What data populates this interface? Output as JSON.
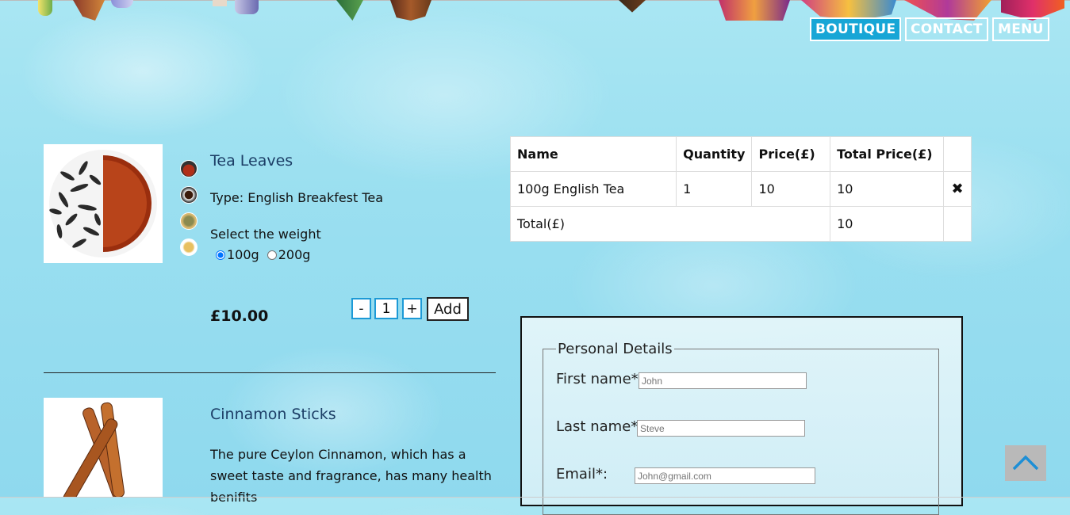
{
  "nav": {
    "boutique": "BOUTIQUE",
    "contact": "CONTACT",
    "menu": "MENU"
  },
  "product1": {
    "title": "Tea Leaves",
    "type": "Type: English Breakfest Tea",
    "weight_prompt": "Select the weight",
    "weight_options": [
      "100g",
      "200g"
    ],
    "selected_weight": "100g",
    "price": "£10.00",
    "quantity": "1",
    "minus": "-",
    "plus": "+",
    "add": "Add"
  },
  "product2": {
    "title": "Cinnamon Sticks",
    "description": "The pure Ceylon Cinnamon, which has a sweet taste and fragrance, has many health benifits"
  },
  "cart": {
    "headers": [
      "Name",
      "Quantity",
      "Price(£)",
      "Total Price(£)"
    ],
    "rows": [
      {
        "name": "100g English Tea",
        "quantity": "1",
        "price": "10",
        "total": "10",
        "remove": "✖"
      }
    ],
    "total_label": "Total(£)",
    "total_value": "10"
  },
  "form": {
    "legend": "Personal Details",
    "first_label": "First name*",
    "first_value": "John",
    "last_label": "Last name*",
    "last_value": "Steve",
    "email_label": "Email*:",
    "email_value": "John@gmail.com"
  },
  "colors": {
    "accent": "#17a6d6",
    "title": "#1c3e66",
    "background": "#9adff0"
  },
  "icons": [
    "close-icon",
    "chevron-up-icon"
  ]
}
